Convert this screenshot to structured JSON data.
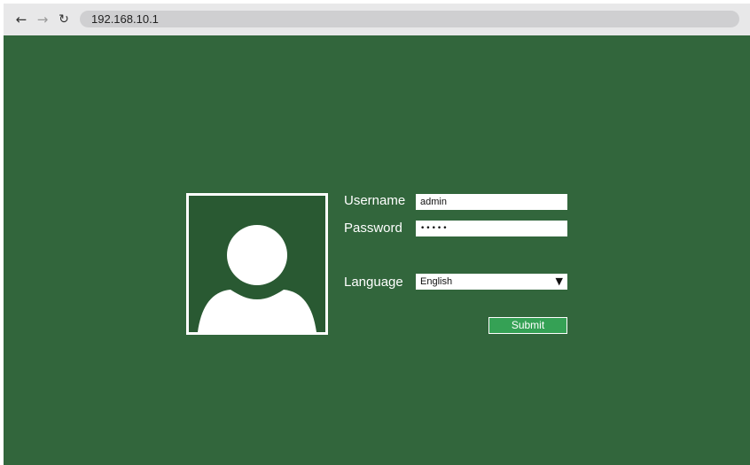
{
  "browser": {
    "back_icon": "arrow-left",
    "forward_icon": "arrow-right",
    "reload_icon": "reload",
    "address": "192.168.10.1"
  },
  "login": {
    "username_label": "Username",
    "username_value": "admin",
    "password_label": "Password",
    "password_value": "•••••",
    "language_label": "Language",
    "language_selected": "English",
    "submit_label": "Submit"
  },
  "colors": {
    "background": "#32663c",
    "avatar_panel": "#295932",
    "submit_button": "#35a155",
    "toolbar": "#e8e8e9"
  }
}
